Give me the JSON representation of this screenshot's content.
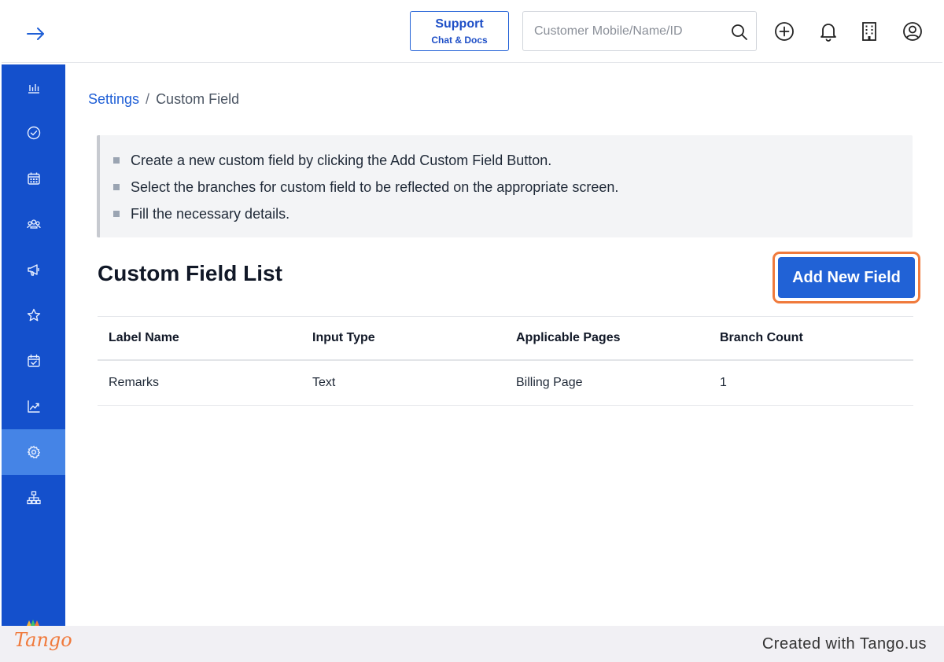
{
  "header": {
    "support": {
      "title": "Support",
      "subtitle": "Chat & Docs"
    },
    "search": {
      "placeholder": "Customer Mobile/Name/ID",
      "value": ""
    }
  },
  "sidebar": {
    "items": [
      {
        "icon": "bar-chart-icon"
      },
      {
        "icon": "check-circle-icon"
      },
      {
        "icon": "calendar-icon"
      },
      {
        "icon": "users-icon"
      },
      {
        "icon": "megaphone-icon"
      },
      {
        "icon": "star-icon"
      },
      {
        "icon": "calendar-check-icon"
      },
      {
        "icon": "trend-chart-icon"
      },
      {
        "icon": "gear-icon",
        "active": true
      },
      {
        "icon": "org-chart-icon"
      }
    ]
  },
  "breadcrumb": {
    "parent": "Settings",
    "separator": "/",
    "current": "Custom Field"
  },
  "instructions": [
    "Create a new custom field by clicking the Add Custom Field Button.",
    "Select the branches for custom field to be reflected on the appropriate screen.",
    "Fill the necessary details."
  ],
  "list": {
    "title": "Custom Field List",
    "add_button": "Add New Field",
    "columns": [
      "Label Name",
      "Input Type",
      "Applicable Pages",
      "Branch Count"
    ],
    "rows": [
      [
        "Remarks",
        "Text",
        "Billing Page",
        "1"
      ]
    ]
  },
  "footer": {
    "logo_text": "Tango",
    "created_with": "Created with Tango.us"
  },
  "colors": {
    "primary": "#1450cc",
    "active_nav": "#4584e6",
    "button": "#2162d6",
    "highlight": "#f07a3c"
  }
}
